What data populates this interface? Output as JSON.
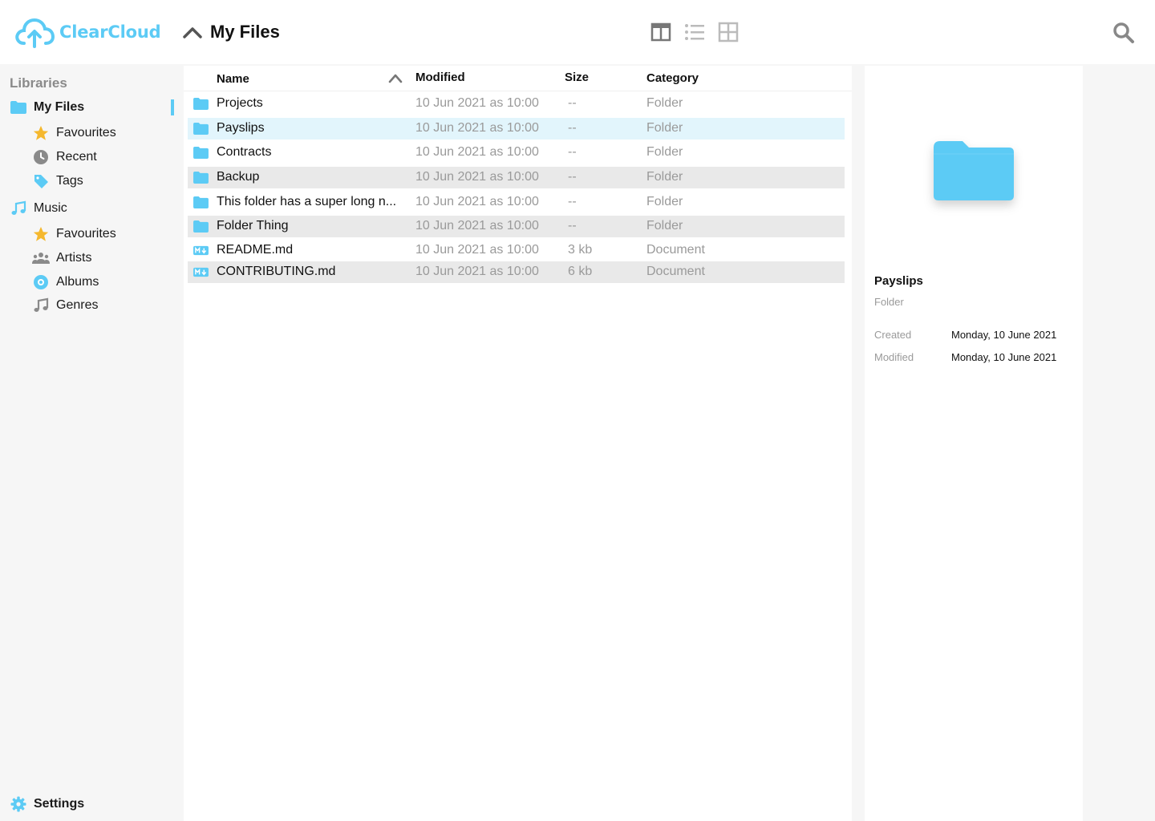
{
  "app": {
    "brand": "ClearCloud",
    "accent": "#5ccbf5"
  },
  "header": {
    "title": "My Files",
    "icons": [
      "up-arrow-icon",
      "columns-view-icon",
      "list-view-icon",
      "grid-view-icon",
      "search-icon"
    ]
  },
  "sidebar": {
    "heading": "Libraries",
    "items": [
      {
        "label": "My Files",
        "icon": "folder-icon",
        "active": true
      },
      {
        "label": "Favourites",
        "icon": "star-icon"
      },
      {
        "label": "Recent",
        "icon": "clock-icon"
      },
      {
        "label": "Tags",
        "icon": "tag-icon"
      },
      {
        "label": "Music",
        "icon": "music-note-icon"
      },
      {
        "label": "Favourites",
        "icon": "star-icon"
      },
      {
        "label": "Artists",
        "icon": "people-icon"
      },
      {
        "label": "Albums",
        "icon": "disc-icon"
      },
      {
        "label": "Genres",
        "icon": "music-note-icon"
      }
    ],
    "settings": "Settings"
  },
  "table": {
    "columns": [
      "Name",
      "Modified",
      "Size",
      "Category"
    ],
    "rows": [
      {
        "name": "Projects",
        "modified": "10 Jun 2021 as 10:00",
        "size": "--",
        "category": "Folder"
      },
      {
        "name": "Payslips",
        "modified": "10 Jun 2021 as 10:00",
        "size": "--",
        "category": "Folder"
      },
      {
        "name": "Contracts",
        "modified": "10 Jun 2021 as 10:00",
        "size": "--",
        "category": "Folder"
      },
      {
        "name": "Backup",
        "modified": "10 Jun 2021 as 10:00",
        "size": "--",
        "category": "Folder"
      },
      {
        "name": "This folder has a super long n...",
        "modified": "10 Jun 2021 as 10:00",
        "size": "--",
        "category": "Folder"
      },
      {
        "name": "Folder Thing",
        "modified": "10 Jun 2021 as 10:00",
        "size": "--",
        "category": "Folder"
      },
      {
        "name": "README.md",
        "modified": "10 Jun 2021 as 10:00",
        "size": "3 kb",
        "category": "Document"
      },
      {
        "name": "CONTRIBUTING.md",
        "modified": "10 Jun 2021 as 10:00",
        "size": "6 kb",
        "category": "Document"
      }
    ]
  },
  "details": {
    "name": "Payslips",
    "type": "Folder",
    "created_label": "Created",
    "created_value": "Monday, 10 June 2021",
    "modified_label": "Modified",
    "modified_value": "Monday, 10 June 2021"
  }
}
